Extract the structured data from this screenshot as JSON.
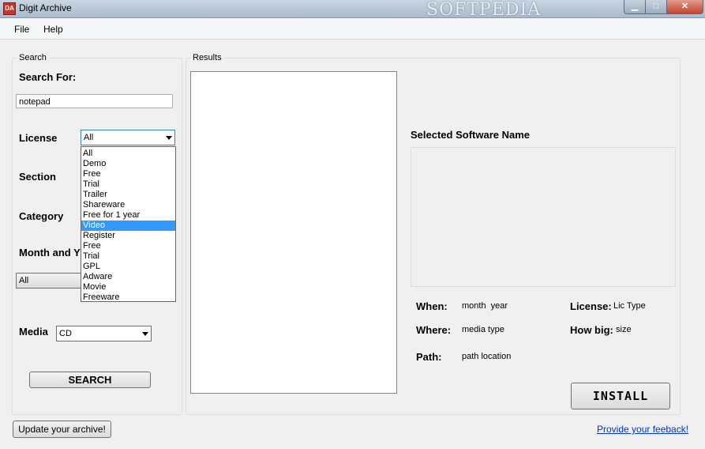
{
  "window": {
    "title": "Digit Archive",
    "app_icon_text": "DA",
    "watermark": "SOFTPEDIA",
    "buttons": {
      "minimize": "▁",
      "maximize": "□",
      "close": "✕"
    }
  },
  "menu": {
    "items": [
      {
        "label": "File"
      },
      {
        "label": "Help"
      }
    ]
  },
  "search": {
    "group_title": "Search",
    "search_for_label": "Search For:",
    "search_value": "notepad",
    "license_label": "License",
    "license_value": "All",
    "license_options": [
      "All",
      "Demo",
      "Free",
      "Trial",
      "Trailer",
      "Shareware",
      "Free for 1 year",
      "Video",
      "Register",
      "Free",
      "Trial",
      "GPL",
      "Adware",
      "Movie",
      "Freeware"
    ],
    "license_highlighted": "Video",
    "section_label": "Section",
    "category_label": "Category",
    "month_label": "Month and Y",
    "month_value": "All",
    "media_label": "Media",
    "media_value": "CD",
    "search_button": "SEARCH"
  },
  "results": {
    "group_title": "Results",
    "selected_name_label": "Selected Software Name",
    "when_label": "When:",
    "when_value": "month  year",
    "where_label": "Where:",
    "where_value": "media type",
    "path_label": "Path:",
    "path_value": "path location",
    "license_label": "License:",
    "license_value": "Lic Type",
    "howbig_label": "How big:",
    "howbig_value": "size",
    "install_button": "INSTALL"
  },
  "footer": {
    "update_button": "Update your archive!",
    "feedback_link": "Provide your feeback!"
  }
}
